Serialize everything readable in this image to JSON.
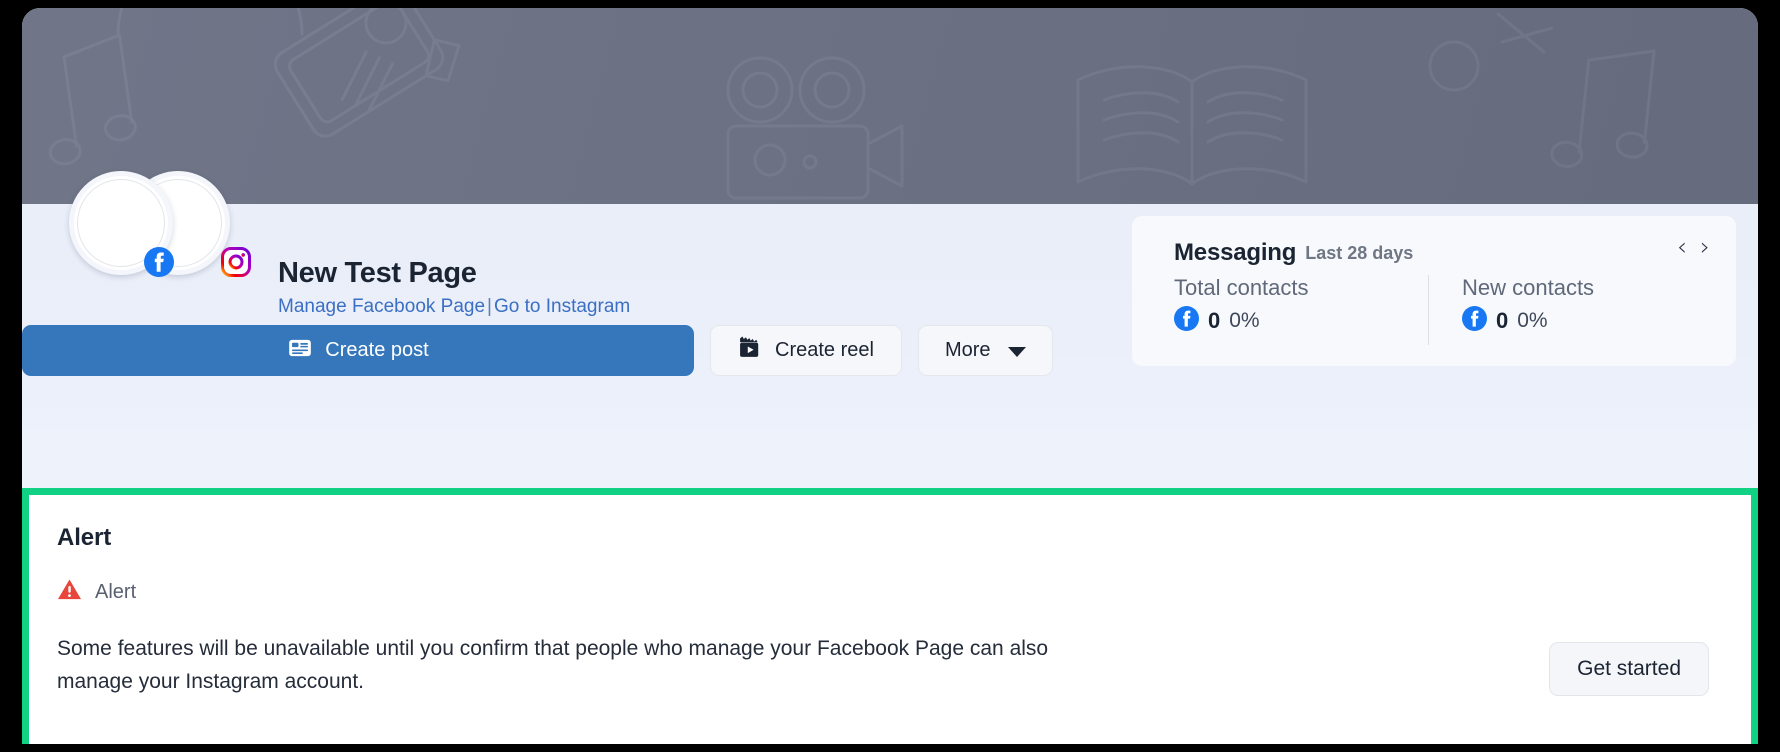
{
  "profile": {
    "page_title": "New Test Page",
    "links": [
      {
        "label": "Manage Facebook Page",
        "name": "manage-facebook-page-link"
      },
      {
        "label": "Go to Instagram",
        "name": "go-to-instagram-link"
      }
    ],
    "link_separator": "|",
    "avatar_badges": [
      "facebook-badge",
      "instagram-badge"
    ]
  },
  "actions": {
    "create_post": "Create post",
    "create_reel": "Create reel",
    "more": "More"
  },
  "messaging": {
    "title": "Messaging",
    "range": "Last 28 days",
    "prev_arrow": "‹",
    "next_arrow": "›",
    "stats": [
      {
        "label": "Total contacts",
        "icon": "facebook-icon",
        "value": "0",
        "percent": "0%"
      },
      {
        "label": "New contacts",
        "icon": "facebook-icon",
        "value": "0",
        "percent": "0%"
      }
    ]
  },
  "alert": {
    "heading": "Alert",
    "subtitle": "Alert",
    "icon": "warning-triangle-icon",
    "message": "Some features will be unavailable until you confirm that people who manage your Facebook Page can also manage your Instagram account.",
    "cta": "Get started",
    "highlight_color": "#10d184",
    "icon_color": "#e8453c"
  },
  "colors": {
    "primary_button": "#3577ba",
    "link": "#3b6fc4",
    "cover_background": "#6b7184",
    "facebook_blue": "#1877f2"
  }
}
